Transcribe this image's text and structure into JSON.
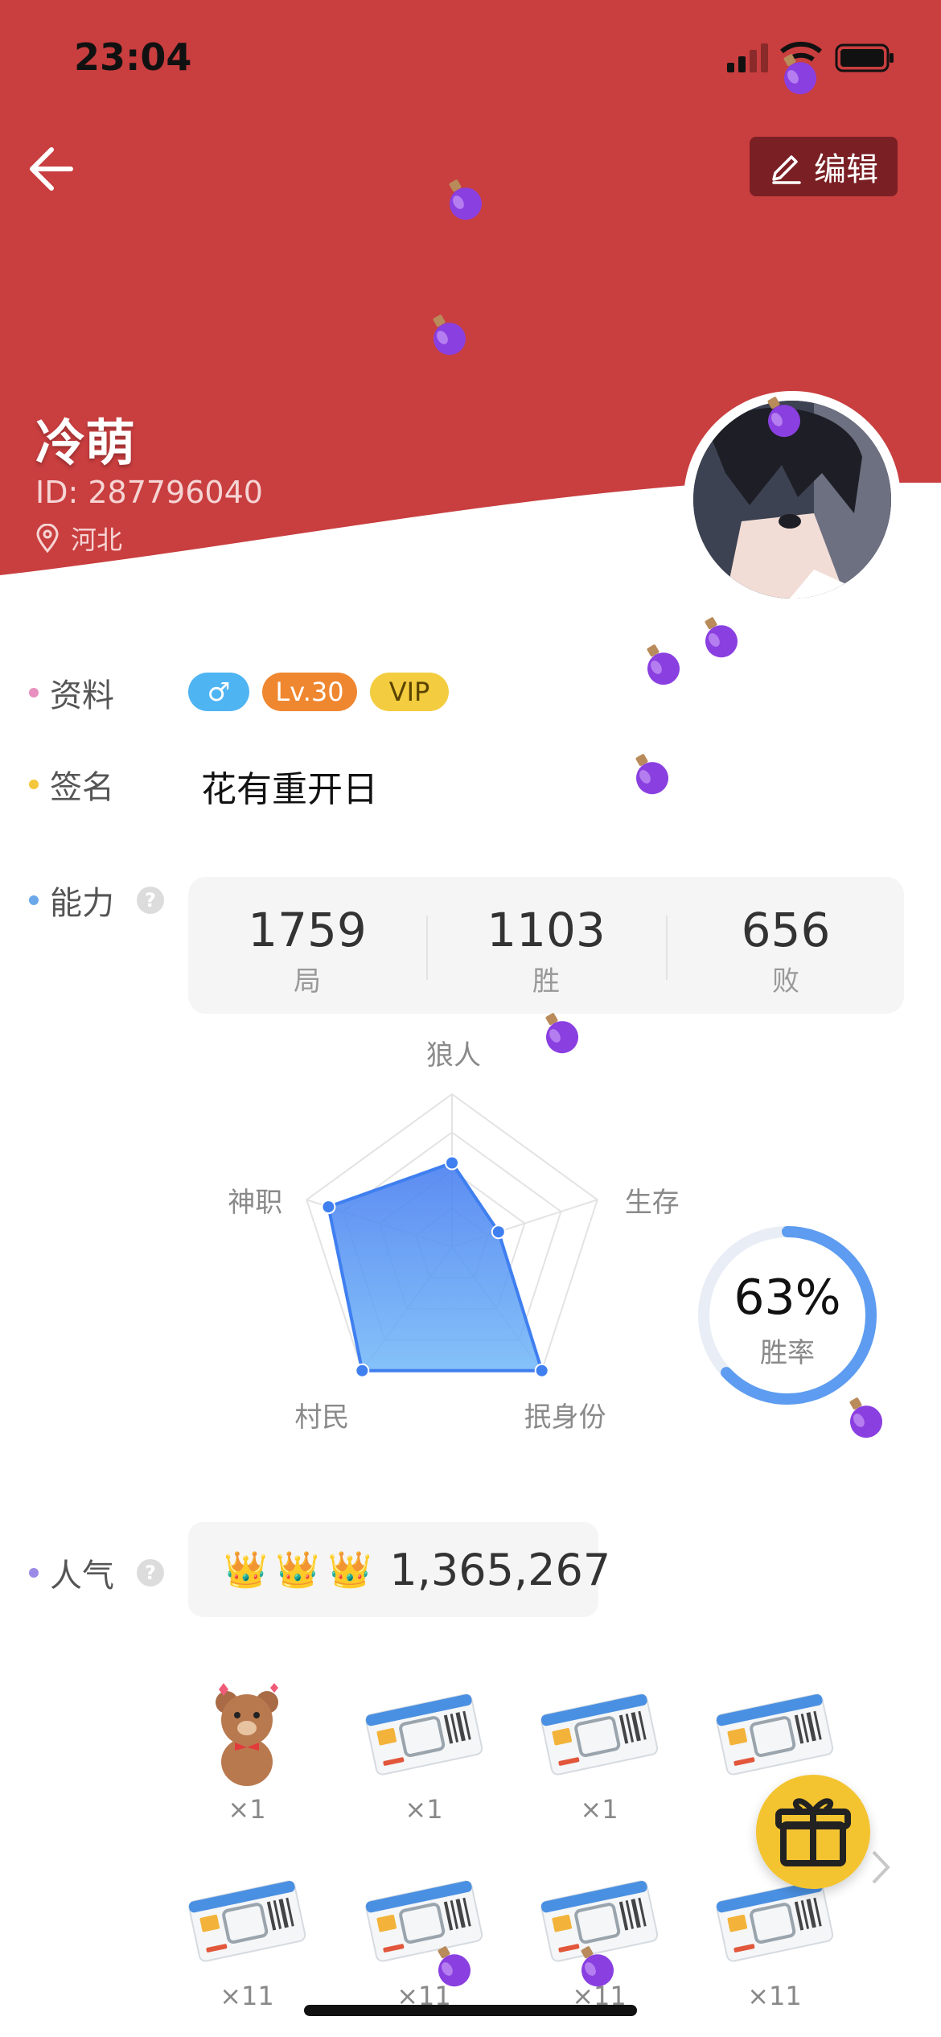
{
  "status_bar": {
    "time": "23:04"
  },
  "header": {
    "edit_label": "编辑",
    "name": "冷萌",
    "id_text": "ID: 287796040",
    "location": "河北",
    "bg_color": "#c93e3f"
  },
  "profile": {
    "label": "资料",
    "gender_tag": "♂",
    "level_tag": "Lv.30",
    "vip_tag": "VIP"
  },
  "signature": {
    "label": "签名",
    "text": "花有重开日"
  },
  "ability": {
    "label": "能力",
    "help": "?",
    "stats": [
      {
        "value": "1759",
        "label": "局"
      },
      {
        "value": "1103",
        "label": "胜"
      },
      {
        "value": "656",
        "label": "败"
      }
    ]
  },
  "chart_data": {
    "type": "radar",
    "axes": [
      "狼人",
      "生存",
      "抿身份",
      "村民",
      "神职"
    ],
    "values": [
      0.55,
      0.32,
      1.0,
      1.0,
      0.85
    ],
    "win_rate": {
      "value": "63%",
      "label": "胜率",
      "fraction": 0.63
    }
  },
  "popularity": {
    "label": "人气",
    "help": "?",
    "value": "1,365,267"
  },
  "gifts": [
    {
      "icon": "teddy-bear",
      "count": "×1"
    },
    {
      "icon": "bus-ticket",
      "count": "×1"
    },
    {
      "icon": "bus-ticket",
      "count": "×1"
    },
    {
      "icon": "bus-ticket",
      "count": ""
    },
    {
      "icon": "bus-ticket",
      "count": "×11"
    },
    {
      "icon": "bus-ticket",
      "count": "×11"
    },
    {
      "icon": "bus-ticket",
      "count": "×11"
    },
    {
      "icon": "bus-ticket",
      "count": "×11"
    }
  ]
}
